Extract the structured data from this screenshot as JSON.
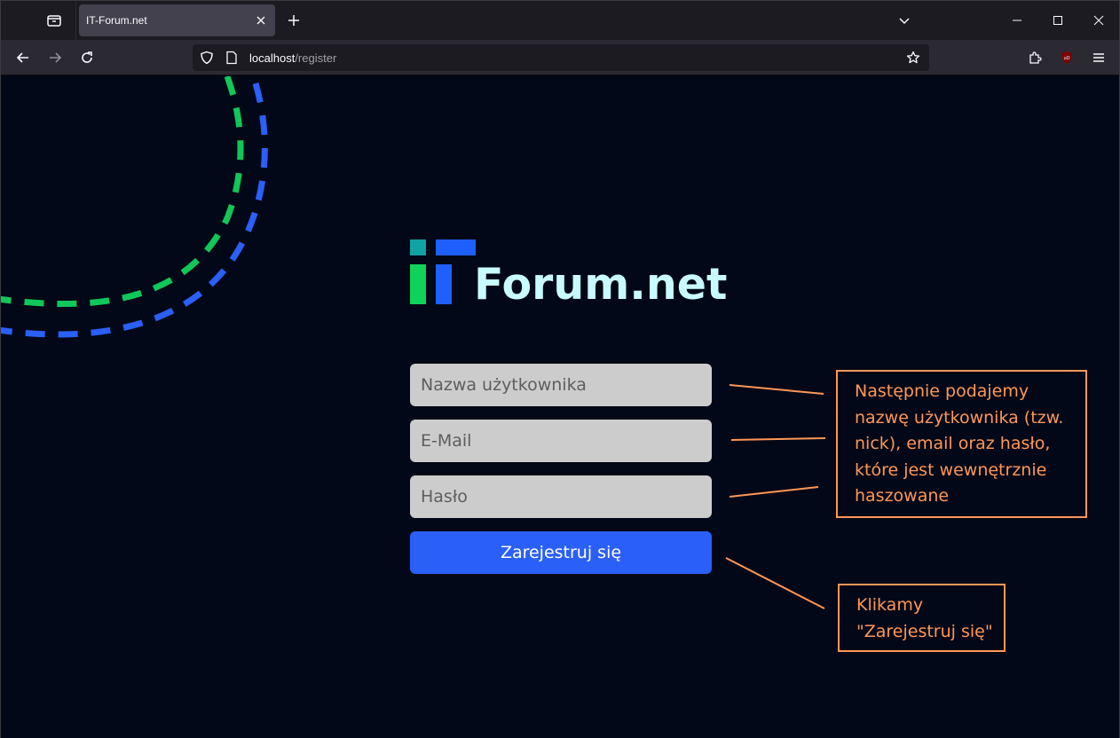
{
  "browser": {
    "tab_title": "IT-Forum.net",
    "url_host": "localhost",
    "url_path": "/register"
  },
  "brand": {
    "name": "Forum.net",
    "colors": {
      "teal": "#0fa3a3",
      "blue": "#1f5fff",
      "green": "#10d25a",
      "text": "#c8fbff"
    }
  },
  "form": {
    "username_placeholder": "Nazwa użytkownika",
    "email_placeholder": "E-Mail",
    "password_placeholder": "Hasło",
    "submit_label": "Zarejestruj się"
  },
  "annotations": {
    "fields_note": "Następnie podajemy nazwę użytkownika (tzw. nick), email oraz hasło, które jest wewnętrznie haszowane",
    "button_note": "Klikamy \"Zarejestruj się\"",
    "color": "#ff9757"
  },
  "icons": [
    "tab-list-icon",
    "close-icon",
    "plus-icon",
    "chevron-down-icon",
    "minimize-icon",
    "maximize-icon",
    "window-close-icon",
    "back-icon",
    "forward-icon",
    "reload-icon",
    "shield-icon",
    "page-icon",
    "star-icon",
    "extensions-icon",
    "ublock-icon",
    "menu-icon"
  ]
}
